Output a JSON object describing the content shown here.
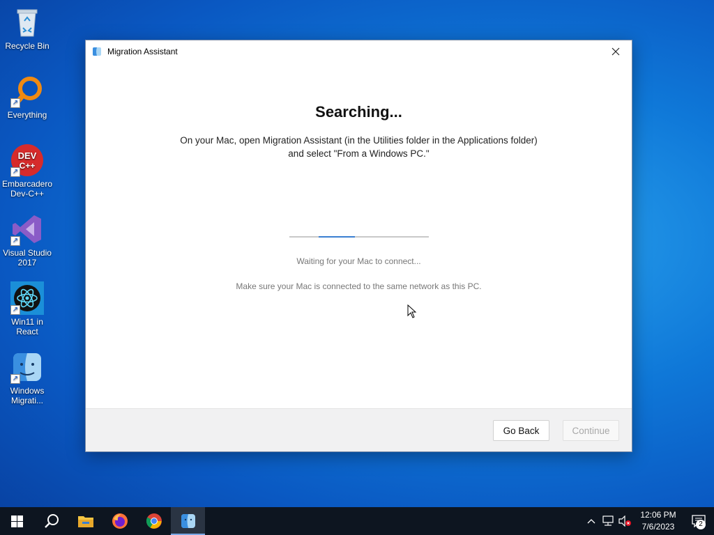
{
  "desktop": {
    "icons": [
      {
        "label": "Recycle Bin"
      },
      {
        "label": "Everything"
      },
      {
        "label": "Embarcadero Dev-C++"
      },
      {
        "label": "Visual Studio 2017"
      },
      {
        "label": "Win11 in React"
      },
      {
        "label": "Windows Migrati..."
      }
    ]
  },
  "window": {
    "title": "Migration Assistant",
    "heading": "Searching...",
    "instruction_line1": "On your Mac, open Migration Assistant (in the Utilities folder in the Applications folder)",
    "instruction_line2": "and select \"From a Windows PC.\"",
    "status": "Waiting for your Mac to connect...",
    "hint": "Make sure your Mac is connected to the same network as this PC.",
    "buttons": {
      "back": "Go Back",
      "continue": "Continue"
    },
    "progress": {
      "state": "indeterminate"
    }
  },
  "taskbar": {
    "pinned": [
      "start-icon",
      "search-icon",
      "file-explorer-icon",
      "firefox-icon",
      "chrome-icon",
      "migration-assistant-icon"
    ],
    "active": "migration-assistant-icon",
    "clock": {
      "time": "12:06 PM",
      "date": "7/6/2023"
    },
    "notification_count": "2"
  },
  "colors": {
    "accent": "#3a7fd1",
    "taskbar": "#0d1520",
    "desktop": "#0f78d8"
  }
}
